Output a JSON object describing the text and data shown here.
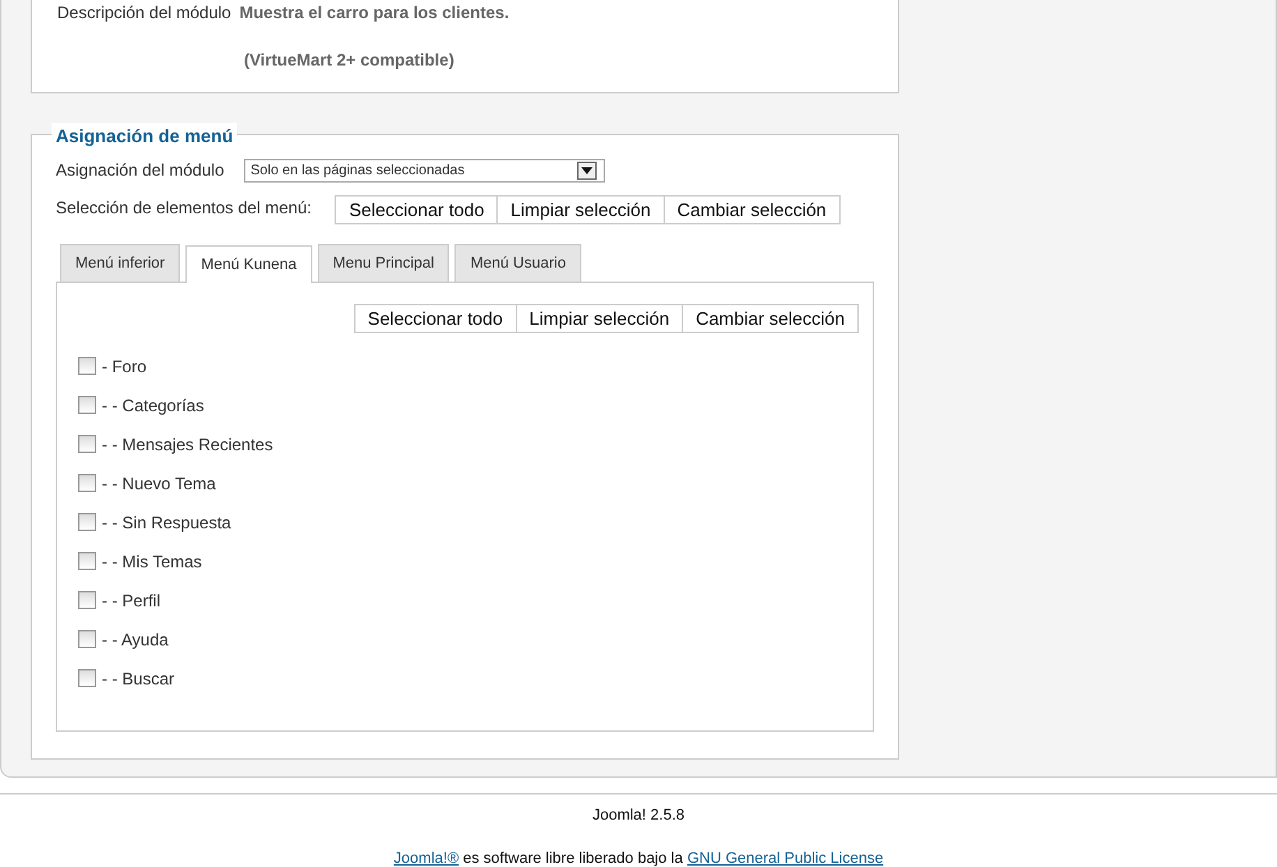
{
  "module_description": {
    "label": "Descripción del módulo",
    "lines": [
      "Muestra el carro para los clientes.",
      "(VirtueMart 2+ compatible)"
    ]
  },
  "menu_assignment": {
    "legend": "Asignación de menú",
    "module_assignment": {
      "label": "Asignación del módulo",
      "value": "Solo en las páginas seleccionadas"
    },
    "selection": {
      "label": "Selección de elementos del menú:",
      "buttons": [
        "Seleccionar todo",
        "Limpiar selección",
        "Cambiar selección"
      ]
    },
    "tabs": [
      {
        "label": "Menú inferior",
        "selected": false
      },
      {
        "label": "Menú Kunena",
        "selected": true
      },
      {
        "label": "Menu Principal",
        "selected": false
      },
      {
        "label": "Menú Usuario",
        "selected": false
      }
    ],
    "panel": {
      "buttons": [
        "Seleccionar todo",
        "Limpiar selección",
        "Cambiar selección"
      ],
      "items": [
        {
          "label": "- Foro",
          "checked": false,
          "children": [
            {
              "label": "- - Categorías",
              "checked": false
            },
            {
              "label": "- - Mensajes Recientes",
              "checked": false
            },
            {
              "label": "- - Nuevo Tema",
              "checked": false
            },
            {
              "label": "- - Sin Respuesta",
              "checked": false
            },
            {
              "label": "- - Mis Temas",
              "checked": false
            },
            {
              "label": "- - Perfil",
              "checked": false
            },
            {
              "label": "- - Ayuda",
              "checked": false
            },
            {
              "label": "- - Buscar",
              "checked": false
            }
          ]
        }
      ]
    }
  },
  "footer": {
    "version": "Joomla! 2.5.8",
    "license": [
      {
        "kind": "link",
        "text": "Joomla!®"
      },
      {
        "kind": "text",
        "text": "es software libre liberado bajo la"
      },
      {
        "kind": "link",
        "text": "GNU General Public License"
      }
    ]
  }
}
